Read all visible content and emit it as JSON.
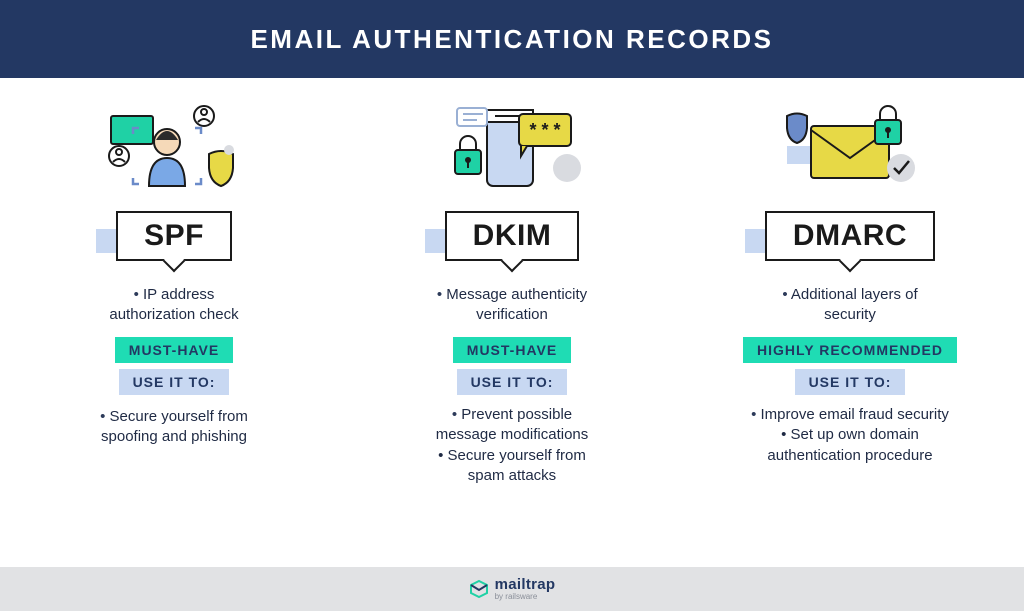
{
  "header": {
    "title": "EMAIL AUTHENTICATION RECORDS"
  },
  "columns": [
    {
      "name": "SPF",
      "desc": [
        "IP address",
        "authorization check"
      ],
      "priority": "MUST-HAVE",
      "useit_label": "USE IT TO:",
      "useit": [
        "Secure yourself from",
        "spoofing and phishing"
      ]
    },
    {
      "name": "DKIM",
      "desc": [
        "Message authenticity",
        "verification"
      ],
      "priority": "MUST-HAVE",
      "useit_label": "USE IT TO:",
      "useit": [
        "Prevent possible",
        "message modifications",
        "• Secure yourself from",
        "spam attacks"
      ]
    },
    {
      "name": "DMARC",
      "desc": [
        "Additional layers of",
        "security"
      ],
      "priority": "HIGHLY RECOMMENDED",
      "useit_label": "USE IT TO:",
      "useit": [
        "Improve email fraud security",
        "• Set up own domain",
        "authentication procedure"
      ]
    }
  ],
  "footer": {
    "brand": "mailtrap",
    "byline": "by railsware"
  }
}
